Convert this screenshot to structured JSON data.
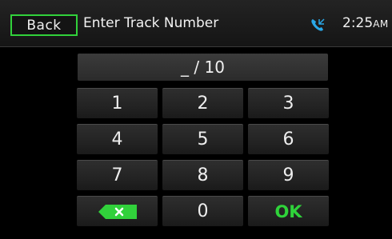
{
  "header": {
    "back_label": "Back",
    "title": "Enter Track Number",
    "phone_icon": "phone-icon",
    "time": "2:25",
    "ampm": "AM"
  },
  "display": {
    "entry": "_ / 10"
  },
  "keypad": {
    "keys": [
      "1",
      "2",
      "3",
      "4",
      "5",
      "6",
      "7",
      "8",
      "9",
      "",
      "0",
      "OK"
    ],
    "backspace_icon": "backspace-icon"
  },
  "colors": {
    "accent_green": "#31d13b",
    "phone_blue": "#2aa8e8",
    "background": "#000000"
  }
}
